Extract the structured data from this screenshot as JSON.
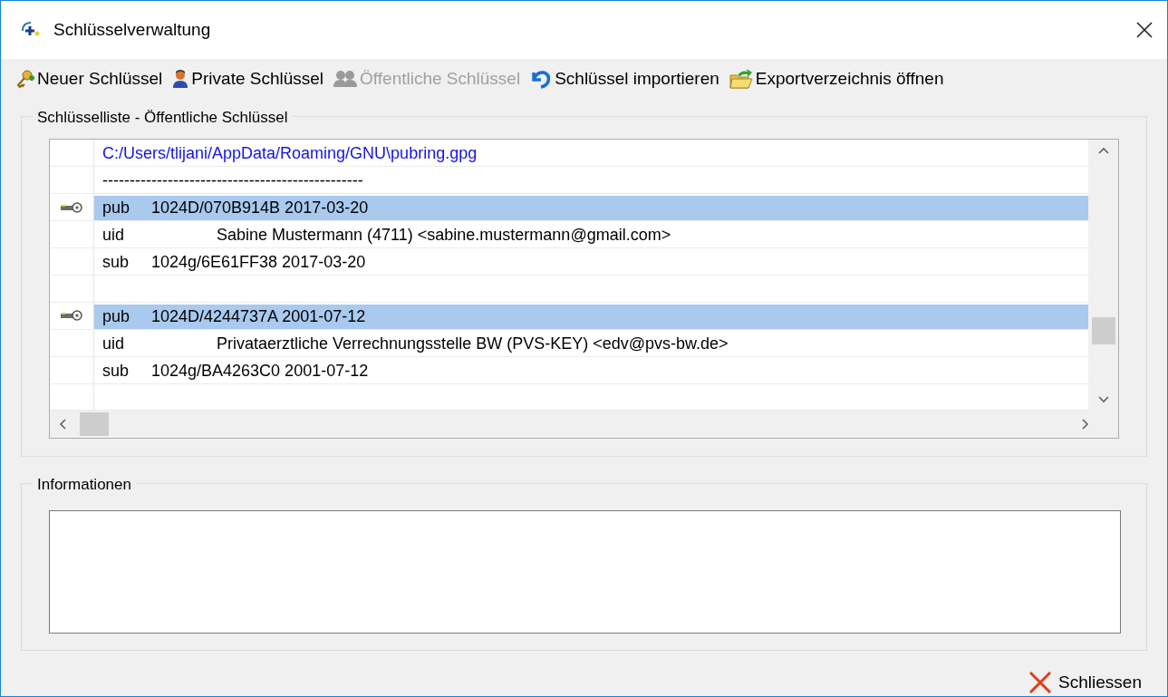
{
  "window": {
    "title": "Schlüsselverwaltung"
  },
  "toolbar": [
    {
      "label": "Neuer Schlüssel",
      "kind": "new-key",
      "disabled": false
    },
    {
      "label": "Private Schlüssel",
      "kind": "private",
      "disabled": false
    },
    {
      "label": "Öffentliche Schlüssel",
      "kind": "public",
      "disabled": true
    },
    {
      "label": "Schlüssel importieren",
      "kind": "import",
      "disabled": false
    },
    {
      "label": "Exportverzeichnis öffnen",
      "kind": "export",
      "disabled": false
    }
  ],
  "key_list": {
    "title": "Schlüsselliste - Öffentliche Schlüssel",
    "rows": [
      {
        "kind": "path",
        "text": "C:/Users/tlijani/AppData/Roaming/GNU\\pubring.gpg",
        "selected": false
      },
      {
        "kind": "separator",
        "text": "------------------------------------------------",
        "selected": false
      },
      {
        "kind": "pub",
        "tag": "pub",
        "text": "1024D/070B914B 2017-03-20",
        "selected": true
      },
      {
        "kind": "uid",
        "tag": "uid",
        "text": "Sabine Mustermann (4711) <sabine.mustermann@gmail.com>",
        "selected": false
      },
      {
        "kind": "sub",
        "tag": "sub",
        "text": "1024g/6E61FF38 2017-03-20",
        "selected": false
      },
      {
        "kind": "blank",
        "selected": false
      },
      {
        "kind": "pub",
        "tag": "pub",
        "text": "1024D/4244737A 2001-07-12",
        "selected": true
      },
      {
        "kind": "uid",
        "tag": "uid",
        "text": "Privataerztliche Verrechnungsstelle BW (PVS-KEY) <edv@pvs-bw.de>",
        "selected": false
      },
      {
        "kind": "sub",
        "tag": "sub",
        "text": "1024g/BA4263C0 2001-07-12",
        "selected": false
      },
      {
        "kind": "blank",
        "selected": false
      }
    ]
  },
  "info": {
    "title": "Informationen"
  },
  "close_button": {
    "label": "Schliessen"
  }
}
